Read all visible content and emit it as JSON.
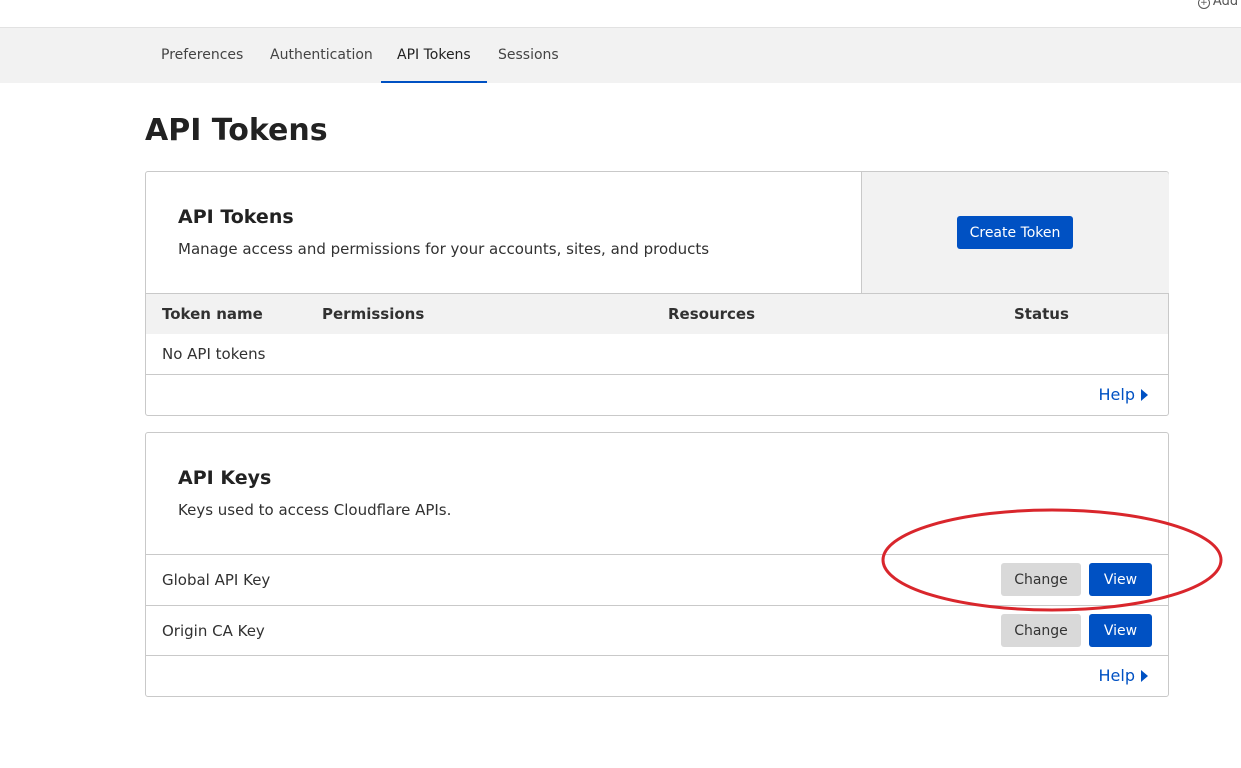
{
  "topbar": {
    "add_label": "Add s"
  },
  "tabs": [
    {
      "label": "Preferences"
    },
    {
      "label": "Authentication"
    },
    {
      "label": "API Tokens"
    },
    {
      "label": "Sessions"
    }
  ],
  "page": {
    "title": "API Tokens"
  },
  "tokens_card": {
    "title": "API Tokens",
    "description": "Manage access and permissions for your accounts, sites, and products",
    "create_button": "Create Token",
    "columns": [
      "Token name",
      "Permissions",
      "Resources",
      "Status"
    ],
    "empty_message": "No API tokens",
    "help": "Help"
  },
  "keys_card": {
    "title": "API Keys",
    "description": "Keys used to access Cloudflare APIs.",
    "rows": [
      {
        "label": "Global API Key",
        "change": "Change",
        "view": "View"
      },
      {
        "label": "Origin CA Key",
        "change": "Change",
        "view": "View"
      }
    ],
    "help": "Help"
  },
  "colors": {
    "accent": "#0051c3",
    "annotation": "#d9262c"
  }
}
